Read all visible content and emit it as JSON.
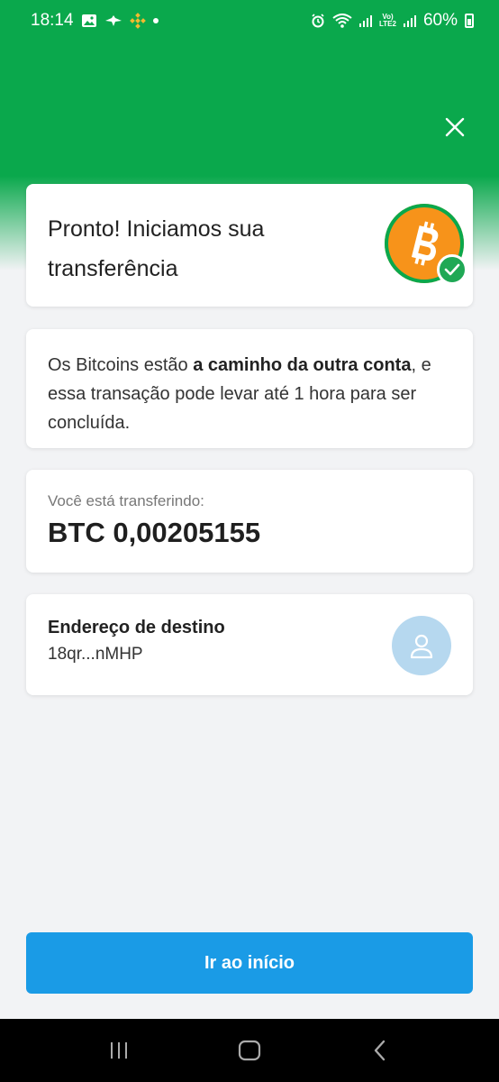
{
  "status_bar": {
    "time": "18:14",
    "volte_top": "Vo)",
    "volte_bottom": "LTE2",
    "battery": "60%"
  },
  "header": {
    "close_icon": "close-icon"
  },
  "title_card": {
    "title": "Pronto! Iniciamos sua transferência",
    "icon": "bitcoin-icon",
    "badge_icon": "check-icon"
  },
  "info_card": {
    "text_before": "Os Bitcoins estão ",
    "text_bold": "a caminho da outra conta",
    "text_after": ", e essa transação pode levar até 1 hora para ser concluída."
  },
  "amount_card": {
    "label": "Você está transferindo:",
    "amount": "BTC 0,00205155"
  },
  "destination_card": {
    "label": "Endereço de destino",
    "address": "18qr...nMHP",
    "icon": "user-icon"
  },
  "actions": {
    "primary_label": "Ir ao início"
  },
  "colors": {
    "header_green": "#0aa84c",
    "bitcoin_orange": "#f7931a",
    "button_blue": "#1a9be6",
    "avatar_bg": "#b6d8ef"
  }
}
